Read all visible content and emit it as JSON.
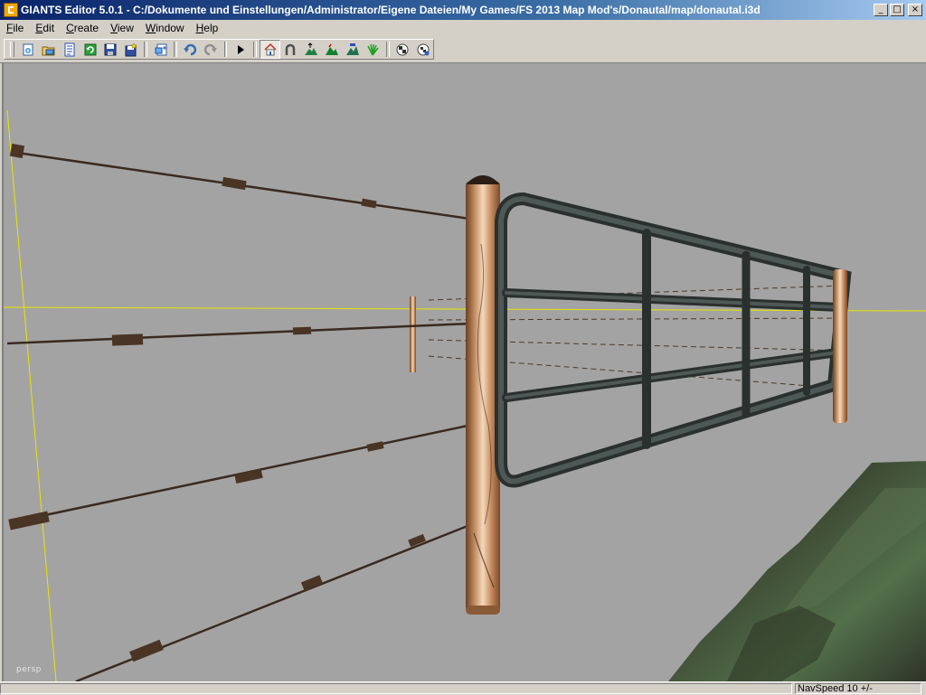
{
  "window": {
    "title": "GIANTS Editor 5.0.1 - C:/Dokumente und Einstellungen/Administrator/Eigene Dateien/My Games/FS 2013 Map Mod's/Donautal/map/donautal.i3d",
    "minimize_glyph": "_",
    "maximize_glyph": "□",
    "close_glyph": "×"
  },
  "menu": [
    {
      "accel": "F",
      "rest": "ile"
    },
    {
      "accel": "E",
      "rest": "dit"
    },
    {
      "accel": "C",
      "rest": "reate"
    },
    {
      "accel": "V",
      "rest": "iew"
    },
    {
      "accel": "W",
      "rest": "indow"
    },
    {
      "accel": "H",
      "rest": "elp"
    }
  ],
  "toolbar": {
    "icons": [
      "new-file-icon",
      "open-file-icon",
      "document-list-icon",
      "refresh-icon",
      "save-icon",
      "save-as-icon",
      "import-icon",
      "undo-icon",
      "redo-icon",
      "play-icon",
      "home-icon",
      "magnet-icon",
      "terrain-up-icon",
      "terrain-paint-icon",
      "terrain-smooth-icon",
      "foliage-icon",
      "checker-icon",
      "checker-settings-icon"
    ]
  },
  "viewport": {
    "camera": "persp",
    "background": "#a3a3a3"
  },
  "statusbar": {
    "nav_speed": "NavSpeed 10 +/-"
  }
}
